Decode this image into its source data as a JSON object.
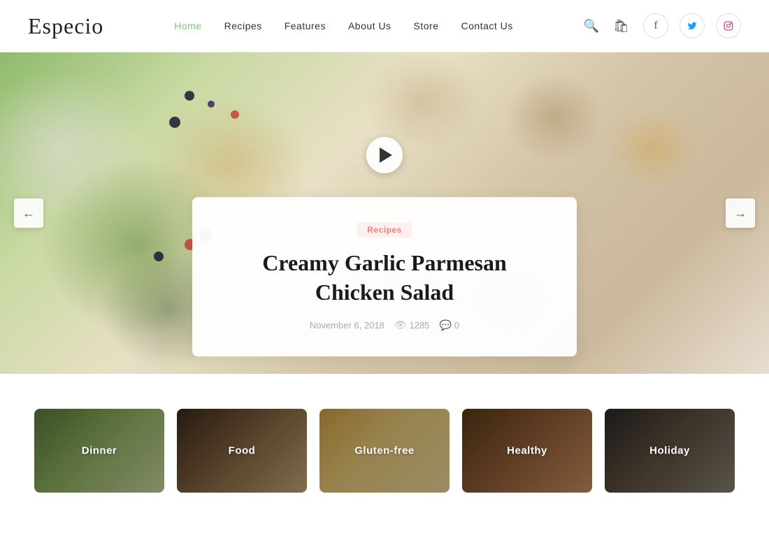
{
  "header": {
    "logo": "Especio",
    "nav": {
      "items": [
        {
          "label": "Home",
          "active": true
        },
        {
          "label": "Recipes",
          "active": false
        },
        {
          "label": "Features",
          "active": false
        },
        {
          "label": "About Us",
          "active": false
        },
        {
          "label": "Store",
          "active": false
        },
        {
          "label": "Contact Us",
          "active": false
        }
      ]
    },
    "social": {
      "facebook": "f",
      "twitter": "t",
      "instagram": "ig"
    }
  },
  "hero": {
    "badge": "Recipes",
    "title": "Creamy Garlic Parmesan Chicken Salad",
    "date": "November 6, 2018",
    "views": "1285",
    "comments": "0"
  },
  "categories": {
    "items": [
      {
        "label": "Dinner",
        "class": "cat-dinner"
      },
      {
        "label": "Food",
        "class": "cat-food"
      },
      {
        "label": "Gluten-free",
        "class": "cat-gluten"
      },
      {
        "label": "Healthy",
        "class": "cat-healthy"
      },
      {
        "label": "Holiday",
        "class": "cat-holiday"
      }
    ]
  }
}
